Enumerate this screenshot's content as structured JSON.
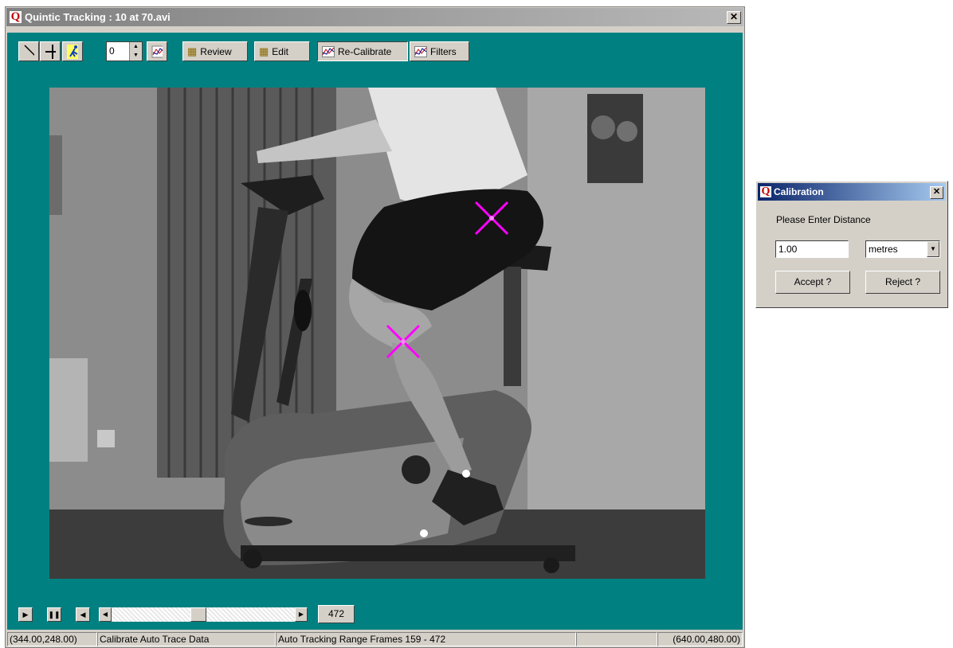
{
  "main_window": {
    "title": "Quintic Tracking : 10 at 70.avi",
    "icon": "Q"
  },
  "toolbar": {
    "spin_value": "0",
    "review_label": "Review",
    "edit_label": "Edit",
    "recalibrate_label": "Re-Calibrate",
    "filters_label": "Filters"
  },
  "controls": {
    "frame_number": "472",
    "scroll_position": 0.47
  },
  "statusbar": {
    "cursor_coords": "(344.00,248.00)",
    "mode": "Calibrate Auto Trace Data",
    "range": "Auto Tracking Range Frames 159 - 472",
    "blank": "",
    "resolution": "(640.00,480.00)"
  },
  "calibration_dialog": {
    "title": "Calibration",
    "icon": "Q",
    "prompt": "Please Enter Distance",
    "distance_value": "1.00",
    "unit": "metres",
    "accept_label": "Accept ?",
    "reject_label": "Reject ?"
  },
  "colors": {
    "teal_background": "#008080",
    "marker_color": "#ff00ff",
    "title_active": "#0a246a"
  }
}
